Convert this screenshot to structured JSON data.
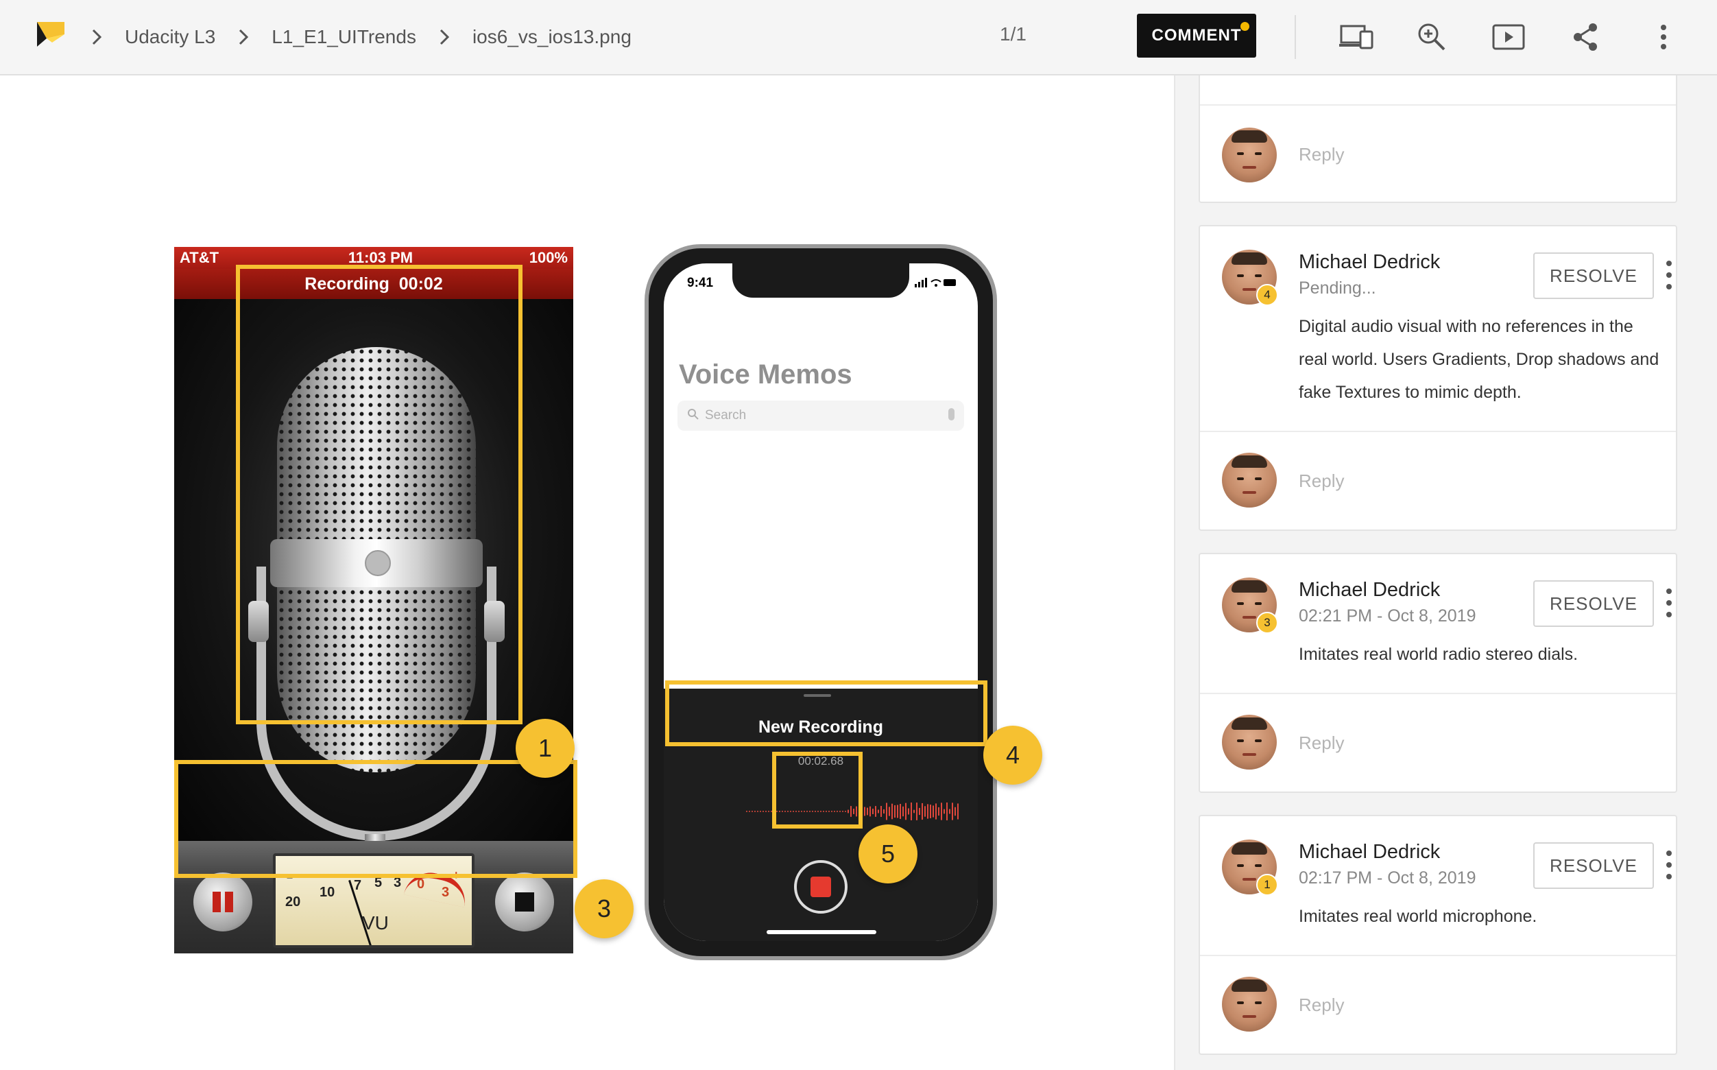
{
  "breadcrumb": [
    "Udacity L3",
    "L1_E1_UITrends",
    "ios6_vs_ios13.png"
  ],
  "pager": "1/1",
  "toolbar": {
    "comment_label": "COMMENT",
    "icons": [
      "devices-icon",
      "zoom-in-icon",
      "present-icon",
      "share-icon",
      "more-vert-icon"
    ]
  },
  "image": {
    "old_phone": {
      "carrier": "AT&T",
      "time": "11:03 PM",
      "battery": "100%",
      "recording_bar": "Recording  00:02",
      "vu_label": "VU",
      "vu_scale": [
        "20",
        "10",
        "7",
        "5",
        "3",
        "0",
        "3",
        "−",
        "+"
      ]
    },
    "new_phone": {
      "time": "9:41",
      "title": "Voice Memos",
      "search_placeholder": "Search",
      "recording_name": "New Recording",
      "recording_time": "00:02.68"
    },
    "markers": [
      "1",
      "3",
      "4",
      "5"
    ]
  },
  "panel": {
    "reply_placeholder": "Reply",
    "resolve_label": "RESOLVE",
    "comments": [
      {
        "number": "4",
        "author": "Michael Dedrick",
        "meta": "Pending...",
        "body_lines": [
          "Digital audio visual with no references in the",
          "real world. Users Gradients, Drop shadows and",
          "fake Textures to mimic depth."
        ]
      },
      {
        "number": "3",
        "author": "Michael Dedrick",
        "meta": "02:21 PM - Oct 8, 2019",
        "body_lines": [
          "Imitates real world radio stereo dials."
        ]
      },
      {
        "number": "1",
        "author": "Michael Dedrick",
        "meta": "02:17 PM - Oct 8, 2019",
        "body_lines": [
          "Imitates real world microphone."
        ]
      }
    ]
  },
  "colors": {
    "accent": "#f6c131",
    "comment_button": "#111111",
    "record_red": "#e53a2f"
  }
}
